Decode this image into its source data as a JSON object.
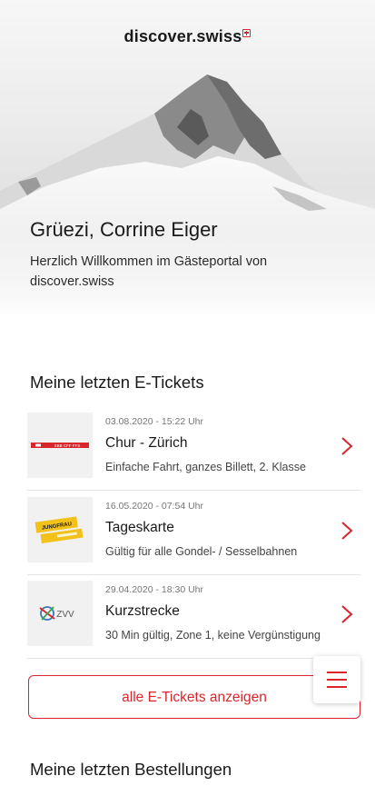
{
  "header": {
    "brand": "discover.swiss",
    "greeting": "Grüezi, Corrine Eiger",
    "subtitle": "Herzlich Willkommen im Gästeportal von discover.swiss"
  },
  "tickets_section": {
    "title": "Meine letzten E-Tickets",
    "items": [
      {
        "date": "03.08.2020 - 15:22 Uhr",
        "name": "Chur - Zürich",
        "description": "Einfache Fahrt, ganzes Billett, 2. Klasse",
        "logo": "sbb-cff-ffs-logo",
        "logo_text": "SBB CFF FFS"
      },
      {
        "date": "16.05.2020 - 07:54 Uhr",
        "name": "Tageskarte",
        "description": "Gültig für alle Gondel- / Sesselbahnen",
        "logo": "jungfrau-ticket-logo",
        "logo_text": "JUNGFRAU"
      },
      {
        "date": "29.04.2020 - 18:30 Uhr",
        "name": "Kurzstrecke",
        "description": "30 Min gültig, Zone 1, keine Vergünstigung",
        "logo": "zvv-logo",
        "logo_text": "ZVV"
      }
    ],
    "all_button": "alle E-Tickets anzeigen"
  },
  "orders_section": {
    "title": "Meine letzten Bestellungen"
  },
  "menu": {
    "icon": "hamburger-menu-icon"
  },
  "colors": {
    "accent": "#d9252c",
    "text": "#1a1a1a",
    "muted": "#777777",
    "divider": "#e4e4e4"
  }
}
